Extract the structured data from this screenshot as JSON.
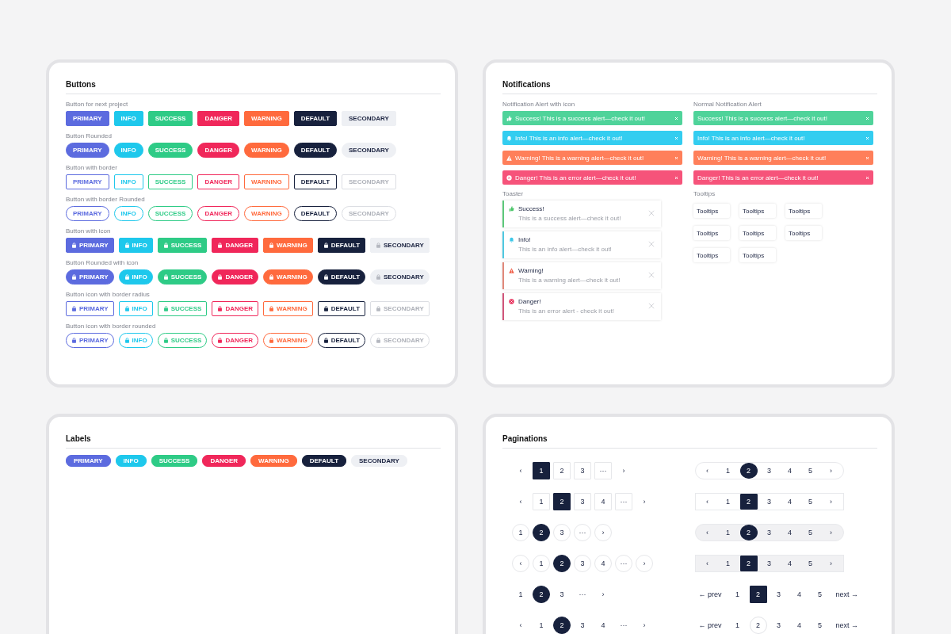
{
  "buttons_panel": {
    "title": "Buttons",
    "groups": [
      {
        "label": "Button for next project",
        "outline": false,
        "rounded": false,
        "icon": false,
        "buttons": [
          {
            "label": "PRIMARY",
            "color": "#5c6bdf"
          },
          {
            "label": "INFO",
            "color": "#1ec8ec"
          },
          {
            "label": "SUCCESS",
            "color": "#2ecb86"
          },
          {
            "label": "DANGER",
            "color": "#f0275a"
          },
          {
            "label": "WARNING",
            "color": "#ff6a3d"
          },
          {
            "label": "DEFAULT",
            "color": "#17213d"
          },
          {
            "label": "SECONDARY",
            "color": "#eef0f4"
          }
        ]
      },
      {
        "label": "Button Rounded",
        "outline": false,
        "rounded": true,
        "icon": false,
        "buttons": [
          {
            "label": "PRIMARY",
            "color": "#5c6bdf"
          },
          {
            "label": "INFO",
            "color": "#1ec8ec"
          },
          {
            "label": "SUCCESS",
            "color": "#2ecb86"
          },
          {
            "label": "DANGER",
            "color": "#f0275a"
          },
          {
            "label": "WARNING",
            "color": "#ff6a3d"
          },
          {
            "label": "DEFAULT",
            "color": "#17213d"
          },
          {
            "label": "SECONDARY",
            "color": "#eef0f4"
          }
        ]
      },
      {
        "label": "Button with border",
        "outline": true,
        "rounded": false,
        "icon": false,
        "buttons": [
          {
            "label": "PRIMARY",
            "color": "#5c6bdf"
          },
          {
            "label": "INFO",
            "color": "#1ec8ec"
          },
          {
            "label": "SUCCESS",
            "color": "#2ecb86"
          },
          {
            "label": "DANGER",
            "color": "#f0275a"
          },
          {
            "label": "WARNING",
            "color": "#ff6a3d"
          },
          {
            "label": "DEFAULT",
            "color": "#17213d"
          },
          {
            "label": "SECONDARY",
            "color": "#dcdee3"
          }
        ]
      },
      {
        "label": "Button with border Rounded",
        "outline": true,
        "rounded": true,
        "icon": false,
        "buttons": [
          {
            "label": "PRIMARY",
            "color": "#5c6bdf"
          },
          {
            "label": "INFO",
            "color": "#1ec8ec"
          },
          {
            "label": "SUCCESS",
            "color": "#2ecb86"
          },
          {
            "label": "DANGER",
            "color": "#f0275a"
          },
          {
            "label": "WARNING",
            "color": "#ff6a3d"
          },
          {
            "label": "DEFAULT",
            "color": "#17213d"
          },
          {
            "label": "SECONDARY",
            "color": "#dcdee3"
          }
        ]
      },
      {
        "label": "Button with icon",
        "outline": false,
        "rounded": false,
        "icon": true,
        "buttons": [
          {
            "label": "PRIMARY",
            "color": "#5c6bdf"
          },
          {
            "label": "INFO",
            "color": "#1ec8ec"
          },
          {
            "label": "SUCCESS",
            "color": "#2ecb86"
          },
          {
            "label": "DANGER",
            "color": "#f0275a"
          },
          {
            "label": "WARNING",
            "color": "#ff6a3d"
          },
          {
            "label": "DEFAULT",
            "color": "#17213d"
          },
          {
            "label": "SECONDARY",
            "color": "#eef0f4"
          }
        ]
      },
      {
        "label": "Button Rounded with icon",
        "outline": false,
        "rounded": true,
        "icon": true,
        "buttons": [
          {
            "label": "PRIMARY",
            "color": "#5c6bdf"
          },
          {
            "label": "INFO",
            "color": "#1ec8ec"
          },
          {
            "label": "SUCCESS",
            "color": "#2ecb86"
          },
          {
            "label": "DANGER",
            "color": "#f0275a"
          },
          {
            "label": "WARNING",
            "color": "#ff6a3d"
          },
          {
            "label": "DEFAULT",
            "color": "#17213d"
          },
          {
            "label": "SECONDARY",
            "color": "#eef0f4"
          }
        ]
      },
      {
        "label": "Button icon with border radius",
        "outline": true,
        "rounded": false,
        "icon": true,
        "buttons": [
          {
            "label": "PRIMARY",
            "color": "#5c6bdf"
          },
          {
            "label": "INFO",
            "color": "#1ec8ec"
          },
          {
            "label": "SUCCESS",
            "color": "#2ecb86"
          },
          {
            "label": "DANGER",
            "color": "#f0275a"
          },
          {
            "label": "WARNING",
            "color": "#ff6a3d"
          },
          {
            "label": "DEFAULT",
            "color": "#17213d"
          },
          {
            "label": "SECONDARY",
            "color": "#dcdee3"
          }
        ]
      },
      {
        "label": "Button icon with border rounded",
        "outline": true,
        "rounded": true,
        "icon": true,
        "buttons": [
          {
            "label": "PRIMARY",
            "color": "#5c6bdf"
          },
          {
            "label": "INFO",
            "color": "#1ec8ec"
          },
          {
            "label": "SUCCESS",
            "color": "#2ecb86"
          },
          {
            "label": "DANGER",
            "color": "#f0275a"
          },
          {
            "label": "WARNING",
            "color": "#ff6a3d"
          },
          {
            "label": "DEFAULT",
            "color": "#17213d"
          },
          {
            "label": "SECONDARY",
            "color": "#dcdee3"
          }
        ]
      }
    ]
  },
  "notifications_panel": {
    "title": "Notifications",
    "alert_sections": [
      {
        "label": "Notification Alert with icon",
        "alerts": [
          {
            "kind": "success",
            "color": "#4fd39a",
            "text": "Success! This is a success alert—check it out!"
          },
          {
            "kind": "info",
            "color": "#33cdf0",
            "text": "Info! This is an info alert—check it out!"
          },
          {
            "kind": "warning",
            "color": "#ff7f5a",
            "text": "Warning! This is a warning alert—check it out!"
          },
          {
            "kind": "danger",
            "color": "#f6537a",
            "text": "Danger! This is an error alert—check it out!"
          }
        ]
      },
      {
        "label": "Normal Notification Alert",
        "alerts": [
          {
            "color": "#4fd39a",
            "text": "Success! This is a success alert—check it out!"
          },
          {
            "color": "#33cdf0",
            "text": "Info! This is an info alert—check it out!"
          },
          {
            "color": "#ff7f5a",
            "text": "Warning! This is a warning alert—check it out!"
          },
          {
            "color": "#f6537a",
            "text": "Danger! This is an error alert—check it out!"
          }
        ]
      }
    ],
    "toaster": {
      "label": "Toaster",
      "toasts": [
        {
          "kind": "success",
          "color": "#5cc87a",
          "title": "Success!",
          "text": "This is a success alert—check it out!"
        },
        {
          "kind": "info",
          "color": "#4fc8e0",
          "title": "Info!",
          "text": "This is an info alert—check it out!"
        },
        {
          "kind": "warning",
          "color": "#e0887a",
          "title": "Warning!",
          "text": "This is a warning alert—check it out!"
        },
        {
          "kind": "danger",
          "color": "#d0557a",
          "title": "Danger!",
          "text": "This is an error alert - check it out!"
        }
      ]
    },
    "tooltips": {
      "label": "Tooltips",
      "items": [
        "Tooltips",
        "Tooltips",
        "Tooltips",
        "Tooltips",
        "Tooltips",
        "Tooltips",
        "Tooltips",
        "Tooltips"
      ]
    }
  },
  "labels_panel": {
    "title": "Labels",
    "labels": [
      {
        "label": "PRIMARY",
        "color": "#5c6bdf"
      },
      {
        "label": "INFO",
        "color": "#1ec8ec"
      },
      {
        "label": "SUCCESS",
        "color": "#2ecb86"
      },
      {
        "label": "DANGER",
        "color": "#f0275a"
      },
      {
        "label": "WARNING",
        "color": "#ff6a3d"
      },
      {
        "label": "DEFAULT",
        "color": "#17213d"
      },
      {
        "label": "SECONDARY",
        "color": "#eef0f4"
      }
    ]
  },
  "paginations_panel": {
    "title": "Paginations",
    "columns": [
      [
        {
          "kind": "boxed",
          "items": [
            {
              "kind": "arrow",
              "label": "‹",
              "selected": false
            },
            {
              "kind": "page",
              "label": "1",
              "selected": true
            },
            {
              "kind": "page",
              "label": "2",
              "selected": false
            },
            {
              "kind": "page",
              "label": "3",
              "selected": false
            },
            {
              "kind": "more",
              "label": "···",
              "selected": false
            },
            {
              "kind": "arrow",
              "label": "›",
              "selected": false
            }
          ]
        },
        {
          "kind": "boxed",
          "items": [
            {
              "kind": "arrow",
              "label": "‹",
              "selected": false
            },
            {
              "kind": "page",
              "label": "1",
              "selected": false
            },
            {
              "kind": "page",
              "label": "2",
              "selected": true
            },
            {
              "kind": "page",
              "label": "3",
              "selected": false
            },
            {
              "kind": "page",
              "label": "4",
              "selected": false
            },
            {
              "kind": "more",
              "label": "···",
              "selected": false
            },
            {
              "kind": "arrow",
              "label": "›",
              "selected": false
            }
          ]
        },
        {
          "kind": "circled",
          "items": [
            {
              "kind": "page",
              "label": "1",
              "selected": false
            },
            {
              "kind": "page",
              "label": "2",
              "selected": true
            },
            {
              "kind": "page",
              "label": "3",
              "selected": false
            },
            {
              "kind": "more",
              "label": "···",
              "selected": false
            },
            {
              "kind": "arrow",
              "label": "›",
              "selected": false
            }
          ]
        },
        {
          "kind": "circled",
          "items": [
            {
              "kind": "arrow",
              "label": "‹",
              "selected": false
            },
            {
              "kind": "page",
              "label": "1",
              "selected": false
            },
            {
              "kind": "page",
              "label": "2",
              "selected": true
            },
            {
              "kind": "page",
              "label": "3",
              "selected": false
            },
            {
              "kind": "page",
              "label": "4",
              "selected": false
            },
            {
              "kind": "more",
              "label": "···",
              "selected": false
            },
            {
              "kind": "arrow",
              "label": "›",
              "selected": false
            }
          ]
        },
        {
          "kind": "plain",
          "items": [
            {
              "kind": "page",
              "label": "1",
              "selected": false
            },
            {
              "kind": "page",
              "label": "2",
              "selected": true
            },
            {
              "kind": "page",
              "label": "3",
              "selected": false
            },
            {
              "kind": "more",
              "label": "···",
              "selected": false
            },
            {
              "kind": "arrow",
              "label": "›",
              "selected": false
            }
          ]
        },
        {
          "kind": "plain",
          "items": [
            {
              "kind": "arrow",
              "label": "‹",
              "selected": false
            },
            {
              "kind": "page",
              "label": "1",
              "selected": false
            },
            {
              "kind": "page",
              "label": "2",
              "selected": true
            },
            {
              "kind": "page",
              "label": "3",
              "selected": false
            },
            {
              "kind": "page",
              "label": "4",
              "selected": false
            },
            {
              "kind": "more",
              "label": "···",
              "selected": false
            },
            {
              "kind": "arrow",
              "label": "›",
              "selected": false
            }
          ]
        }
      ],
      [
        {
          "kind": "pill",
          "items": [
            {
              "kind": "arrow",
              "label": "‹",
              "selected": false
            },
            {
              "kind": "page",
              "label": "1",
              "selected": false
            },
            {
              "kind": "page",
              "label": "2",
              "selected": true
            },
            {
              "kind": "page",
              "label": "3",
              "selected": false
            },
            {
              "kind": "page",
              "label": "4",
              "selected": false
            },
            {
              "kind": "page",
              "label": "5",
              "selected": false
            },
            {
              "kind": "arrow",
              "label": "›",
              "selected": false
            }
          ]
        },
        {
          "kind": "bar",
          "items": [
            {
              "kind": "arrow",
              "label": "‹",
              "selected": false
            },
            {
              "kind": "page",
              "label": "1",
              "selected": false
            },
            {
              "kind": "page",
              "label": "2",
              "selected": true
            },
            {
              "kind": "page",
              "label": "3",
              "selected": false
            },
            {
              "kind": "page",
              "label": "4",
              "selected": false
            },
            {
              "kind": "page",
              "label": "5",
              "selected": false
            },
            {
              "kind": "arrow",
              "label": "›",
              "selected": false
            }
          ]
        },
        {
          "kind": "shadedpill",
          "items": [
            {
              "kind": "arrow",
              "label": "‹",
              "selected": false
            },
            {
              "kind": "page",
              "label": "1",
              "selected": false
            },
            {
              "kind": "page",
              "label": "2",
              "selected": true
            },
            {
              "kind": "page",
              "label": "3",
              "selected": false
            },
            {
              "kind": "page",
              "label": "4",
              "selected": false
            },
            {
              "kind": "page",
              "label": "5",
              "selected": false
            },
            {
              "kind": "arrow",
              "label": "›",
              "selected": false
            }
          ]
        },
        {
          "kind": "shadedbar",
          "items": [
            {
              "kind": "arrow",
              "label": "‹",
              "selected": false
            },
            {
              "kind": "page",
              "label": "1",
              "selected": false
            },
            {
              "kind": "page",
              "label": "2",
              "selected": true
            },
            {
              "kind": "page",
              "label": "3",
              "selected": false
            },
            {
              "kind": "page",
              "label": "4",
              "selected": false
            },
            {
              "kind": "page",
              "label": "5",
              "selected": false
            },
            {
              "kind": "arrow",
              "label": "›",
              "selected": false
            }
          ]
        },
        {
          "kind": "textual",
          "items": [
            {
              "kind": "text",
              "label": "← prev",
              "selected": false
            },
            {
              "kind": "page",
              "label": "1",
              "selected": false
            },
            {
              "kind": "page",
              "label": "2",
              "selected": true
            },
            {
              "kind": "page",
              "label": "3",
              "selected": false
            },
            {
              "kind": "page",
              "label": "4",
              "selected": false
            },
            {
              "kind": "page",
              "label": "5",
              "selected": false
            },
            {
              "kind": "text",
              "label": "next →",
              "selected": false
            }
          ]
        },
        {
          "kind": "textring",
          "items": [
            {
              "kind": "text",
              "label": "← prev",
              "selected": false
            },
            {
              "kind": "page",
              "label": "1",
              "selected": false
            },
            {
              "kind": "page",
              "label": "2",
              "selected": true
            },
            {
              "kind": "page",
              "label": "3",
              "selected": false
            },
            {
              "kind": "page",
              "label": "4",
              "selected": false
            },
            {
              "kind": "page",
              "label": "5",
              "selected": false
            },
            {
              "kind": "text",
              "label": "next →",
              "selected": false
            }
          ]
        }
      ]
    ]
  }
}
